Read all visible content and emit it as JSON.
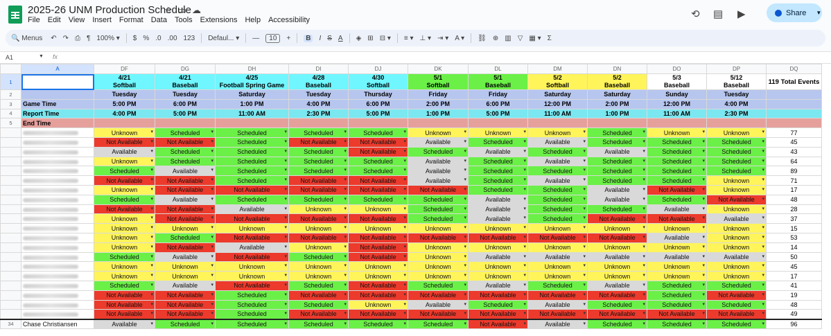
{
  "title": "2025-26 UNM Production Schedule",
  "menu": [
    "File",
    "Edit",
    "View",
    "Insert",
    "Format",
    "Data",
    "Tools",
    "Extensions",
    "Help",
    "Accessibility"
  ],
  "share_label": "Share",
  "toolbar": {
    "search": "Menus",
    "zoom": "100%",
    "currency": "$",
    "percent": "%",
    "dec_decrease": ".0",
    "dec_increase": ".00",
    "number_format": "123",
    "font": "Defaul...",
    "font_size": "10",
    "bold": "B",
    "italic": "I",
    "strike": "S",
    "text_color": "A"
  },
  "name_box": "A1",
  "fx": "fx",
  "columns": [
    "A",
    "DF",
    "DG",
    "DH",
    "DI",
    "DJ",
    "DK",
    "DL",
    "DM",
    "DN",
    "DO",
    "DP",
    "DQ"
  ],
  "events": [
    {
      "date": "4/21",
      "sport": "Softball",
      "day": "Tuesday",
      "game": "5:00 PM",
      "report": "4:00 PM",
      "color": "cyan"
    },
    {
      "date": "4/21",
      "sport": "Baseball",
      "day": "Tuesday",
      "game": "6:00 PM",
      "report": "5:00 PM",
      "color": "cyan"
    },
    {
      "date": "4/25",
      "sport": "Football Spring Game",
      "day": "Saturday",
      "game": "1:00 PM",
      "report": "11:00 AM",
      "color": "cyan"
    },
    {
      "date": "4/28",
      "sport": "Baseball",
      "day": "Tuesday",
      "game": "4:00 PM",
      "report": "2:30 PM",
      "color": "cyan"
    },
    {
      "date": "4/30",
      "sport": "Softball",
      "day": "Thursday",
      "game": "6:00 PM",
      "report": "5:00 PM",
      "color": "cyan"
    },
    {
      "date": "5/1",
      "sport": "Softball",
      "day": "Friday",
      "game": "2:00 PM",
      "report": "1:00 PM",
      "color": "green"
    },
    {
      "date": "5/1",
      "sport": "Baseball",
      "day": "Friday",
      "game": "6:00 PM",
      "report": "5:00 PM",
      "color": "green"
    },
    {
      "date": "5/2",
      "sport": "Softball",
      "day": "Saturday",
      "game": "12:00 PM",
      "report": "11:00 AM",
      "color": "yellow"
    },
    {
      "date": "5/2",
      "sport": "Baseball",
      "day": "Saturday",
      "game": "2:00 PM",
      "report": "1:00 PM",
      "color": "yellow"
    },
    {
      "date": "5/3",
      "sport": "Baseball",
      "day": "Sunday",
      "game": "12:00 PM",
      "report": "11:00 AM",
      "color": "white"
    },
    {
      "date": "5/12",
      "sport": "Baseball",
      "day": "Tuesday",
      "game": "4:00 PM",
      "report": "2:30 PM",
      "color": "white"
    }
  ],
  "total_header": "119 Total Events",
  "row_labels": {
    "game": "Game Time",
    "report": "Report Time",
    "end": "End Time"
  },
  "row_numbers": [
    "1",
    "2",
    "3",
    "4",
    "5"
  ],
  "last_row_number": "34",
  "status_text": {
    "U": "Unknown",
    "N": "Not Available",
    "A": "Available",
    "S": "Scheduled"
  },
  "people": [
    {
      "name": "",
      "statuses": [
        "U",
        "S",
        "S",
        "S",
        "S",
        "U",
        "U",
        "U",
        "S",
        "U",
        "U"
      ],
      "count": "77"
    },
    {
      "name": "",
      "statuses": [
        "N",
        "N",
        "S",
        "N",
        "N",
        "A",
        "S",
        "A",
        "S",
        "S",
        "S"
      ],
      "count": "45"
    },
    {
      "name": "",
      "statuses": [
        "A",
        "S",
        "S",
        "S",
        "N",
        "S",
        "A",
        "S",
        "A",
        "S",
        "S"
      ],
      "count": "43"
    },
    {
      "name": "",
      "statuses": [
        "U",
        "S",
        "S",
        "S",
        "S",
        "A",
        "S",
        "A",
        "S",
        "S",
        "S"
      ],
      "count": "64"
    },
    {
      "name": "",
      "statuses": [
        "S",
        "A",
        "S",
        "S",
        "S",
        "A",
        "S",
        "S",
        "S",
        "S",
        "S"
      ],
      "count": "89"
    },
    {
      "name": "",
      "statuses": [
        "N",
        "N",
        "S",
        "N",
        "N",
        "A",
        "S",
        "A",
        "S",
        "S",
        "U"
      ],
      "count": "71"
    },
    {
      "name": "",
      "statuses": [
        "U",
        "N",
        "N",
        "N",
        "N",
        "N",
        "S",
        "S",
        "A",
        "N",
        "U"
      ],
      "count": "17"
    },
    {
      "name": "",
      "statuses": [
        "S",
        "A",
        "S",
        "S",
        "S",
        "S",
        "A",
        "S",
        "A",
        "S",
        "N"
      ],
      "count": "48"
    },
    {
      "name": "",
      "statuses": [
        "N",
        "N",
        "A",
        "U",
        "U",
        "S",
        "A",
        "S",
        "S",
        "A",
        "U"
      ],
      "count": "28"
    },
    {
      "name": "",
      "statuses": [
        "U",
        "N",
        "N",
        "N",
        "N",
        "S",
        "A",
        "S",
        "N",
        "N",
        "A"
      ],
      "count": "37"
    },
    {
      "name": "",
      "statuses": [
        "U",
        "U",
        "U",
        "U",
        "U",
        "U",
        "U",
        "U",
        "U",
        "U",
        "U"
      ],
      "count": "15"
    },
    {
      "name": "",
      "statuses": [
        "U",
        "S",
        "N",
        "N",
        "N",
        "N",
        "N",
        "N",
        "N",
        "A",
        "U"
      ],
      "count": "53"
    },
    {
      "name": "",
      "statuses": [
        "U",
        "N",
        "A",
        "U",
        "N",
        "U",
        "U",
        "U",
        "U",
        "U",
        "U"
      ],
      "count": "14"
    },
    {
      "name": "",
      "statuses": [
        "S",
        "A",
        "N",
        "S",
        "N",
        "U",
        "A",
        "A",
        "A",
        "A",
        "A"
      ],
      "count": "50"
    },
    {
      "name": "",
      "statuses": [
        "U",
        "U",
        "U",
        "U",
        "U",
        "U",
        "U",
        "U",
        "U",
        "U",
        "U"
      ],
      "count": "45"
    },
    {
      "name": "",
      "statuses": [
        "U",
        "U",
        "U",
        "U",
        "U",
        "U",
        "U",
        "U",
        "U",
        "U",
        "U"
      ],
      "count": "17"
    },
    {
      "name": "",
      "statuses": [
        "S",
        "A",
        "N",
        "S",
        "N",
        "S",
        "A",
        "S",
        "A",
        "S",
        "S"
      ],
      "count": "41"
    },
    {
      "name": "",
      "statuses": [
        "N",
        "N",
        "S",
        "N",
        "N",
        "N",
        "N",
        "N",
        "N",
        "S",
        "N"
      ],
      "count": "19"
    },
    {
      "name": "",
      "statuses": [
        "N",
        "N",
        "S",
        "S",
        "U",
        "A",
        "S",
        "A",
        "S",
        "S",
        "S"
      ],
      "count": "48"
    },
    {
      "name": "",
      "statuses": [
        "N",
        "N",
        "S",
        "N",
        "N",
        "N",
        "N",
        "N",
        "N",
        "N",
        "N"
      ],
      "count": "49"
    },
    {
      "name": "Chase Christiansen",
      "statuses": [
        "A",
        "S",
        "S",
        "S",
        "S",
        "S",
        "N",
        "A",
        "S",
        "S",
        "S"
      ],
      "count": "96"
    }
  ]
}
